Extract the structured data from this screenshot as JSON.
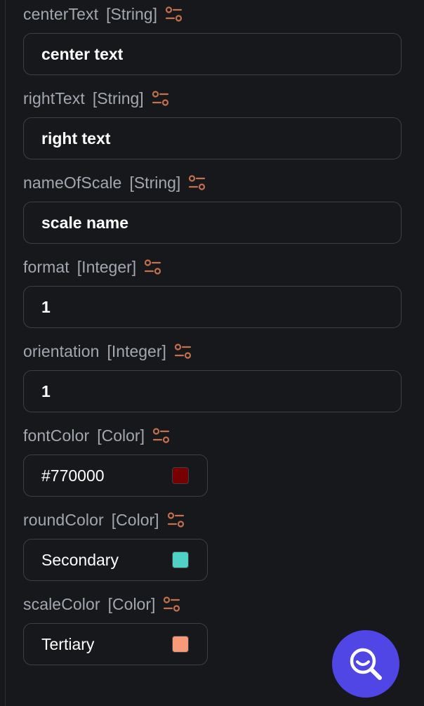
{
  "properties": [
    {
      "name": "centerText",
      "type": "[String]",
      "value": "center text"
    },
    {
      "name": "rightText",
      "type": "[String]",
      "value": "right text"
    },
    {
      "name": "nameOfScale",
      "type": "[String]",
      "value": "scale name"
    },
    {
      "name": "format",
      "type": "[Integer]",
      "value": "1"
    },
    {
      "name": "orientation",
      "type": "[Integer]",
      "value": "1"
    },
    {
      "name": "fontColor",
      "type": "[Color]",
      "value": "#770000",
      "swatch": "#770000"
    },
    {
      "name": "roundColor",
      "type": "[Color]",
      "value": "Secondary",
      "swatch": "#4fd1c5"
    },
    {
      "name": "scaleColor",
      "type": "[Color]",
      "value": "Tertiary",
      "swatch": "#f69a7a"
    }
  ],
  "colors": {
    "accent_icon": "#c2704e",
    "fab": "#4f46e5",
    "background": "#16181c",
    "border": "#3b3f46",
    "label": "#a3a8b0"
  },
  "icons": {
    "settings": "settings-sliders-icon",
    "fab": "search-icon"
  }
}
